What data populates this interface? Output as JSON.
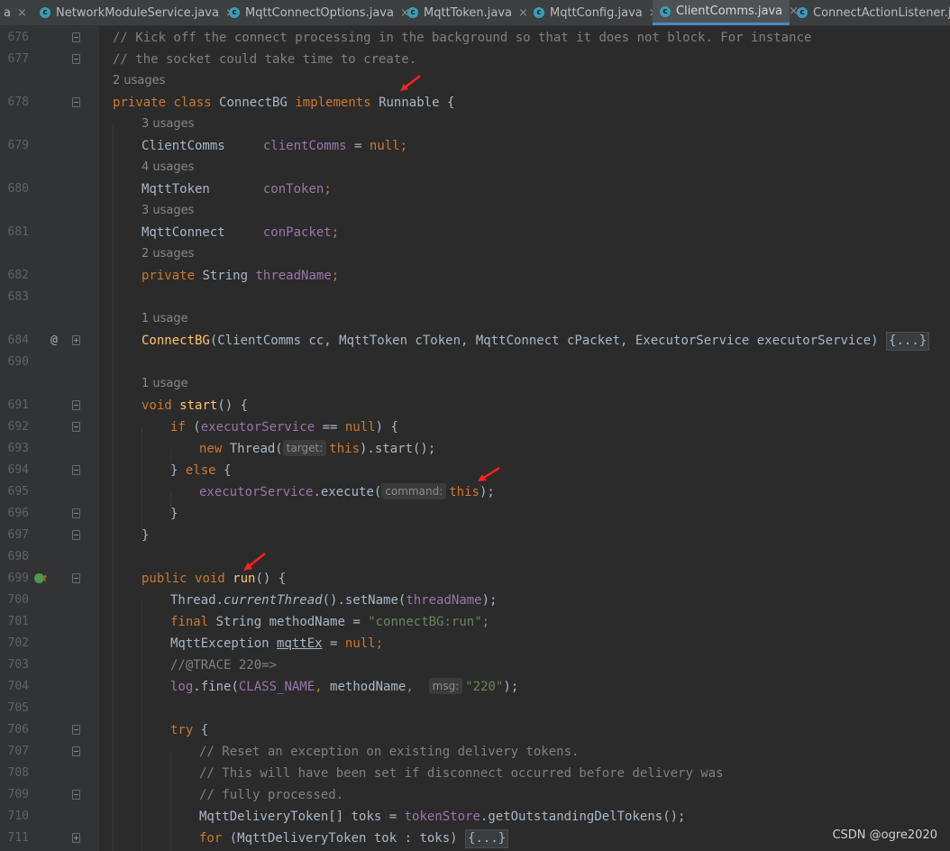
{
  "tabs": [
    {
      "label": "a",
      "icon": "none"
    },
    {
      "label": "NetworkModuleService.java",
      "icon": "class-icon"
    },
    {
      "label": "MqttConnectOptions.java",
      "icon": "class-icon"
    },
    {
      "label": "MqttToken.java",
      "icon": "class-icon"
    },
    {
      "label": "MqttConfig.java",
      "icon": "class-icon"
    },
    {
      "label": "ClientComms.java",
      "icon": "class-icon",
      "active": true
    },
    {
      "label": "ConnectActionListener.java",
      "icon": "class-icon"
    }
  ],
  "tab_close_glyph": "×",
  "class_icon_glyph": "c",
  "gutter": {
    "annotation_glyph": "@",
    "override_glyph": "↑"
  },
  "editor": {
    "line_numbers": [
      "676",
      "677",
      "678",
      "679",
      "680",
      "681",
      "682",
      "683",
      "684",
      "690",
      "691",
      "692",
      "693",
      "694",
      "695",
      "696",
      "697",
      "698",
      "699",
      "700",
      "701",
      "702",
      "703",
      "704",
      "705",
      "706",
      "707",
      "708",
      "709",
      "710",
      "711"
    ],
    "usages": {
      "u678": "2 usages",
      "u679": "3 usages",
      "u680": "4 usages",
      "u681": "3 usages",
      "u682": "2 usages",
      "u684": "1 usage",
      "u691": "1 usage"
    },
    "hints": {
      "target": "target:",
      "command": "command:",
      "msg": "msg:"
    },
    "folded": "{...}",
    "tokens": {
      "c676": "// Kick off the connect processing in the background so that it does not block. For instance",
      "c677": "// the socket could take time to create.",
      "private": "private",
      "class": "class",
      "ConnectBG": "ConnectBG",
      "implements": "implements",
      "Runnable": "Runnable",
      "openBrace": " {",
      "ClientComms": "ClientComms",
      "clientComms": "clientComms",
      "eq": " = ",
      "null": "null",
      "semi": ";",
      "MqttToken": "MqttToken",
      "conToken": "conToken",
      "MqttConnect": "MqttConnect",
      "conPacket": "conPacket",
      "String": "String",
      "threadName": "threadName",
      "ctorArgs": "(ClientComms cc, MqttToken cToken, MqttConnect cPacket, ExecutorService executorService)",
      "void": "void",
      "start": "start",
      "parens": "()",
      "if": "if",
      "openParen": " (",
      "executorService": "executorService",
      "eqeq": " == ",
      "closeBraceOpen": ") {",
      "new": "new",
      "Thread": "Thread(",
      "this": "this",
      "dotStart": ").start();",
      "closeBrace": "}",
      "else": "else",
      "execute": ".execute(",
      "closeParenSemi": ");",
      "public": "public",
      "run": "run",
      "ThreadDot": "Thread.",
      "currentThread": "currentThread",
      "setName": "().setName(",
      "final": "final",
      "methodName": "methodName",
      "connectBGrun": "\"connectBG:run\"",
      "MqttException": "MqttException",
      "mqttEx": "mqttEx",
      "trace": "//@TRACE 220=>",
      "log": "log",
      "fine": ".fine(",
      "CLASS_NAME": "CLASS_NAME",
      "comma": ",",
      "s220": "\"220\"",
      "try": "try",
      "c707": "// Reset an exception on existing delivery tokens.",
      "c708": "// This will have been set if disconnect occurred before delivery was",
      "c709": "// fully processed.",
      "MqttDeliveryTokenArr": "MqttDeliveryToken[]",
      "toks": "toks",
      "tokenStore": "tokenStore",
      "getOutstanding": ".getOutstandingDelTokens();",
      "for": "for",
      "forArgs": "(MqttDeliveryToken tok : toks)"
    }
  },
  "watermark": "CSDN @ogre2020",
  "colors": {
    "background": "#2b2b2b",
    "keyword": "#cc7832",
    "field": "#9876aa",
    "method": "#ffc66d",
    "string": "#6a8759",
    "comment": "#808080",
    "annotation_arrow": "#ff2020"
  }
}
